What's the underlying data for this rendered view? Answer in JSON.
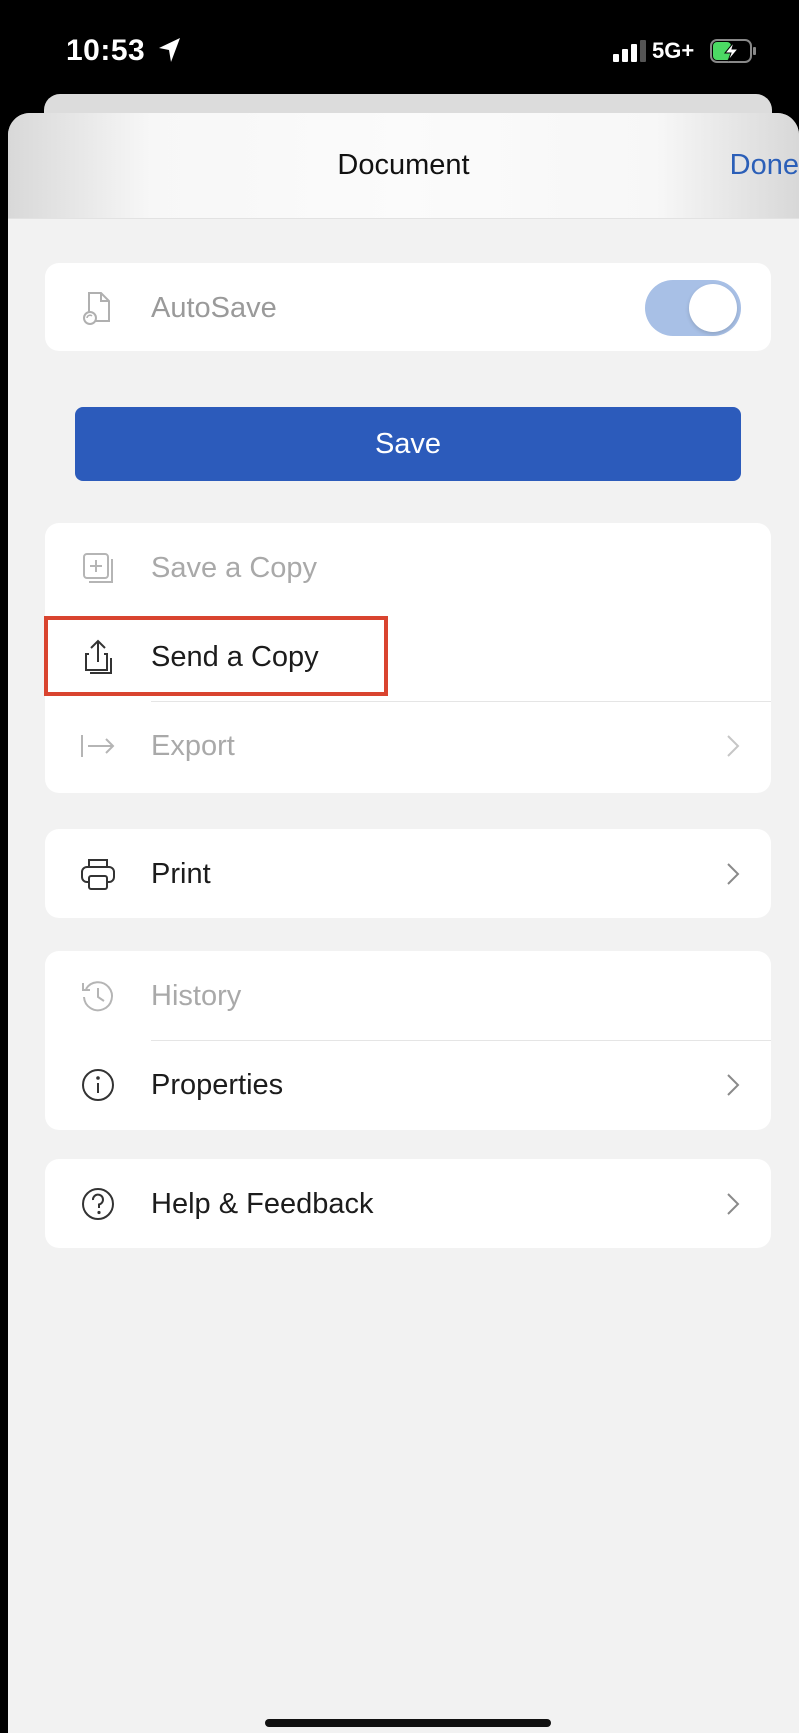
{
  "status_bar": {
    "time": "10:53",
    "network": "5G+",
    "location_icon": "location-arrow-icon",
    "signal_icon": "signal-bars-icon",
    "battery_icon": "battery-charging-icon"
  },
  "nav": {
    "title": "Document",
    "done_label": "Done"
  },
  "autosave": {
    "label": "AutoSave",
    "icon": "autosave-document-icon",
    "enabled": true
  },
  "save_button": {
    "label": "Save"
  },
  "copy_section": {
    "items": [
      {
        "label": "Save a Copy",
        "icon": "add-copy-icon",
        "disabled": true
      },
      {
        "label": "Send a Copy",
        "icon": "share-icon",
        "disabled": false,
        "highlighted": true
      },
      {
        "label": "Export",
        "icon": "export-arrow-icon",
        "disabled": true,
        "chevron": true
      }
    ]
  },
  "print_section": {
    "items": [
      {
        "label": "Print",
        "icon": "printer-icon",
        "chevron": true
      }
    ]
  },
  "info_section": {
    "items": [
      {
        "label": "History",
        "icon": "history-icon",
        "disabled": true
      },
      {
        "label": "Properties",
        "icon": "info-icon",
        "chevron": true
      }
    ]
  },
  "help_section": {
    "items": [
      {
        "label": "Help & Feedback",
        "icon": "question-icon",
        "chevron": true
      }
    ]
  },
  "colors": {
    "accent": "#2b5fb8",
    "save_button": "#2c5bbb",
    "toggle_on": "#a8c0e6",
    "highlight_border": "#d9442f",
    "disabled_text": "#a9a9a9"
  }
}
